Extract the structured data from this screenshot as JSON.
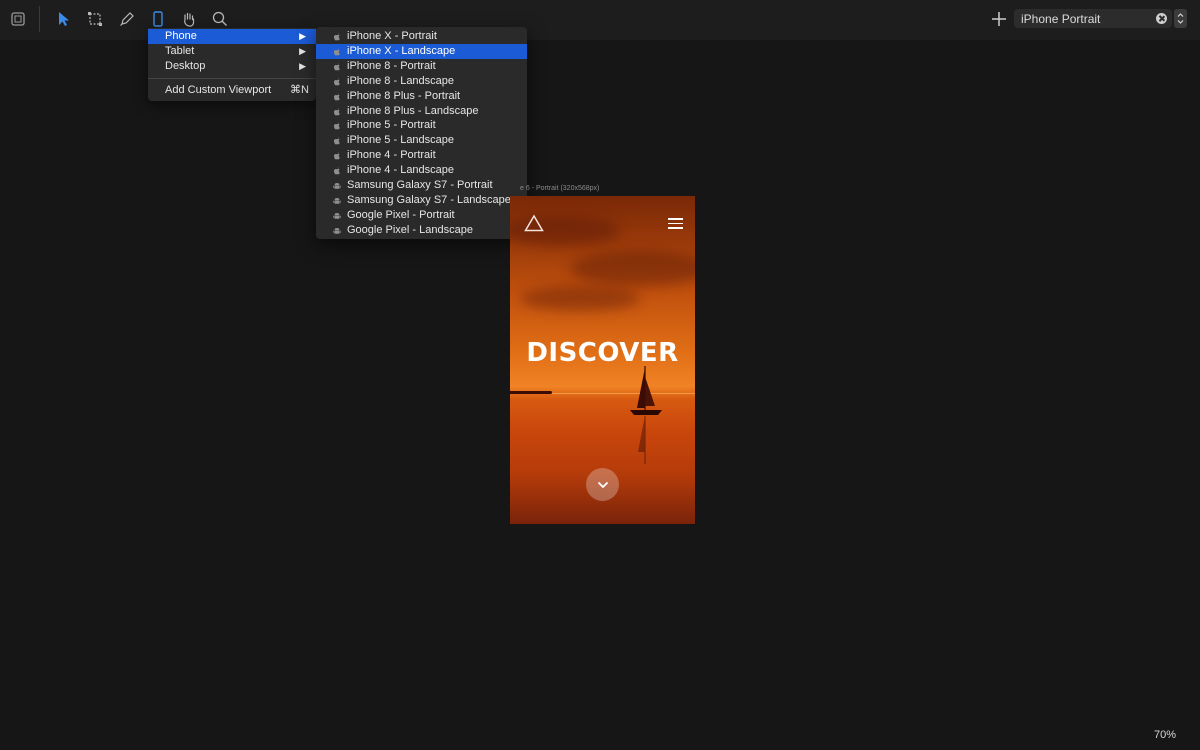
{
  "toolbar": {
    "tools": [
      "panel-toggle-icon",
      "pointer-icon",
      "artboard-icon",
      "pen-icon",
      "device-icon",
      "hand-icon",
      "zoom-icon"
    ],
    "accent_color": "#3b8beb"
  },
  "viewport_search": {
    "value": "iPhone Portrait"
  },
  "menu": {
    "items": [
      {
        "label": "Phone",
        "arrow": "▶"
      },
      {
        "label": "Tablet",
        "arrow": "▶"
      },
      {
        "label": "Desktop",
        "arrow": "▶"
      }
    ],
    "custom": {
      "label": "Add Custom Viewport",
      "shortcut": "⌘N"
    }
  },
  "submenu": {
    "items": [
      {
        "label": "iPhone X - Portrait",
        "icon": "apple-icon"
      },
      {
        "label": "iPhone X - Landscape",
        "icon": "apple-icon"
      },
      {
        "label": "iPhone 8 - Portrait",
        "icon": "apple-icon"
      },
      {
        "label": "iPhone 8 - Landscape",
        "icon": "apple-icon"
      },
      {
        "label": "iPhone 8 Plus - Portrait",
        "icon": "apple-icon"
      },
      {
        "label": "iPhone 8 Plus - Landscape",
        "icon": "apple-icon"
      },
      {
        "label": "iPhone 5 - Portrait",
        "icon": "apple-icon"
      },
      {
        "label": "iPhone 5 - Landscape",
        "icon": "apple-icon"
      },
      {
        "label": "iPhone 4 - Portrait",
        "icon": "apple-icon"
      },
      {
        "label": "iPhone 4 - Landscape",
        "icon": "apple-icon"
      },
      {
        "label": "Samsung Galaxy S7 - Portrait",
        "icon": "android-icon"
      },
      {
        "label": "Samsung Galaxy S7 - Landscape",
        "icon": "android-icon"
      },
      {
        "label": "Google Pixel - Portrait",
        "icon": "android-icon"
      },
      {
        "label": "Google Pixel - Landscape",
        "icon": "android-icon"
      }
    ],
    "selected_color": "#1c5bd6"
  },
  "artboard": {
    "label": "e 6 - Portrait (320x568px)",
    "hero_title": "DISCOVER"
  },
  "status": {
    "zoom": "70%"
  }
}
